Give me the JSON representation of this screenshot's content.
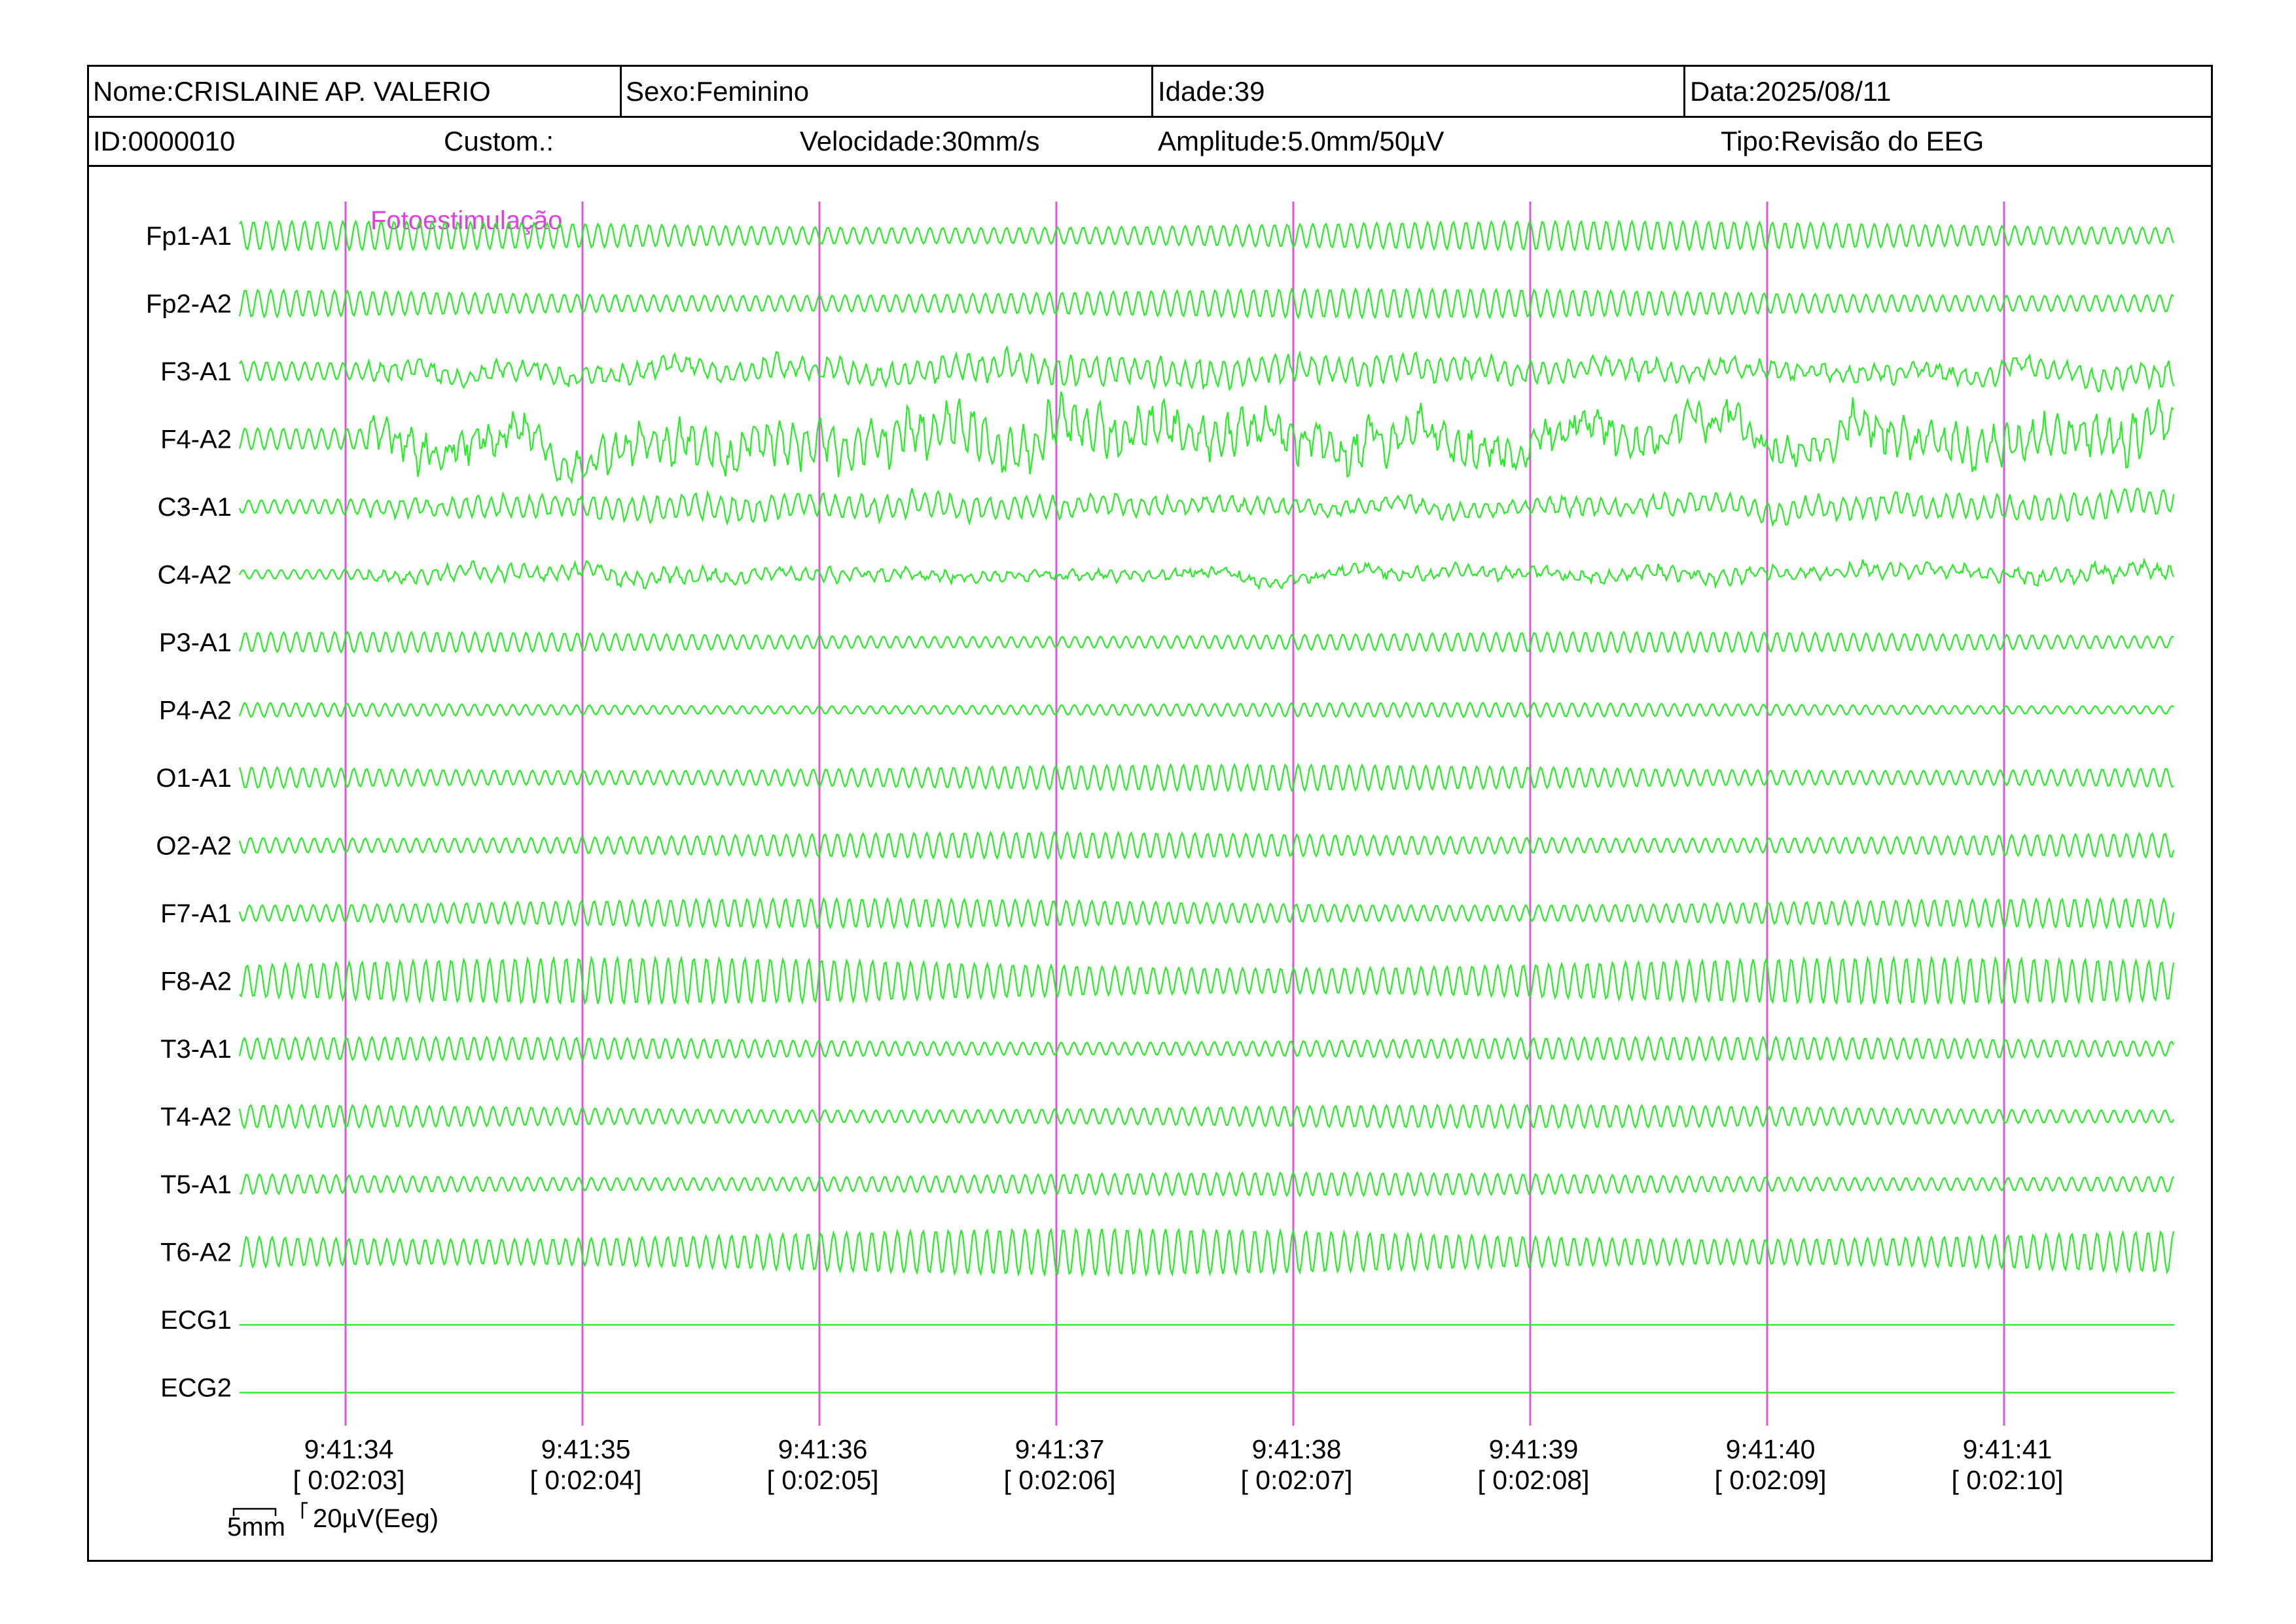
{
  "header": {
    "nome": "Nome:CRISLAINE AP. VALERIO",
    "sexo": "Sexo:Feminino",
    "idade": "Idade:39",
    "data": "Data:2025/08/11",
    "id": "ID:0000010",
    "custom": "Custom.:",
    "velocidade": "Velocidade:30mm/s",
    "amplitude": "Amplitude:5.0mm/50µV",
    "tipo": "Tipo:Revisão do EEG"
  },
  "event_label": "Fotoestimulação",
  "colors": {
    "trace": "#22ee22",
    "marker": "#dd55dd",
    "event_text": "#e040e0"
  },
  "channels": [
    {
      "name": "Fp1-A1",
      "amp": 1.0,
      "artifact": 0,
      "flat": false
    },
    {
      "name": "Fp2-A2",
      "amp": 1.0,
      "artifact": 0,
      "flat": false
    },
    {
      "name": "F3-A1",
      "amp": 0.9,
      "artifact": 0.4,
      "flat": false
    },
    {
      "name": "F4-A2",
      "amp": 1.3,
      "artifact": 1.0,
      "flat": false
    },
    {
      "name": "C3-A1",
      "amp": 0.8,
      "artifact": 0.3,
      "flat": false
    },
    {
      "name": "C4-A2",
      "amp": 0.4,
      "artifact": 0.35,
      "flat": false
    },
    {
      "name": "P3-A1",
      "amp": 0.7,
      "artifact": 0,
      "flat": false
    },
    {
      "name": "P4-A2",
      "amp": 0.5,
      "artifact": 0,
      "flat": false
    },
    {
      "name": "O1-A1",
      "amp": 0.9,
      "artifact": 0,
      "flat": false
    },
    {
      "name": "O2-A2",
      "amp": 0.9,
      "artifact": 0,
      "flat": false
    },
    {
      "name": "F7-A1",
      "amp": 1.0,
      "artifact": 0,
      "flat": false
    },
    {
      "name": "F8-A2",
      "amp": 1.6,
      "artifact": 0,
      "flat": false
    },
    {
      "name": "T3-A1",
      "amp": 0.8,
      "artifact": 0,
      "flat": false
    },
    {
      "name": "T4-A2",
      "amp": 0.8,
      "artifact": 0,
      "flat": false
    },
    {
      "name": "T5-A1",
      "amp": 0.8,
      "artifact": 0,
      "flat": false
    },
    {
      "name": "T6-A2",
      "amp": 1.6,
      "artifact": 0,
      "flat": false
    },
    {
      "name": "ECG1",
      "amp": 0,
      "artifact": 0,
      "flat": true
    },
    {
      "name": "ECG2",
      "amp": 0,
      "artifact": 0,
      "flat": true
    }
  ],
  "time_marks": [
    {
      "clock": "9:41:34",
      "elapsed": "[ 0:02:03]"
    },
    {
      "clock": "9:41:35",
      "elapsed": "[ 0:02:04]"
    },
    {
      "clock": "9:41:36",
      "elapsed": "[ 0:02:05]"
    },
    {
      "clock": "9:41:37",
      "elapsed": "[ 0:02:06]"
    },
    {
      "clock": "9:41:38",
      "elapsed": "[ 0:02:07]"
    },
    {
      "clock": "9:41:39",
      "elapsed": "[ 0:02:08]"
    },
    {
      "clock": "9:41:40",
      "elapsed": "[ 0:02:09]"
    },
    {
      "clock": "9:41:41",
      "elapsed": "[ 0:02:10]"
    }
  ],
  "scale": {
    "time": "5mm",
    "amplitude": "20µV(Eeg)"
  }
}
